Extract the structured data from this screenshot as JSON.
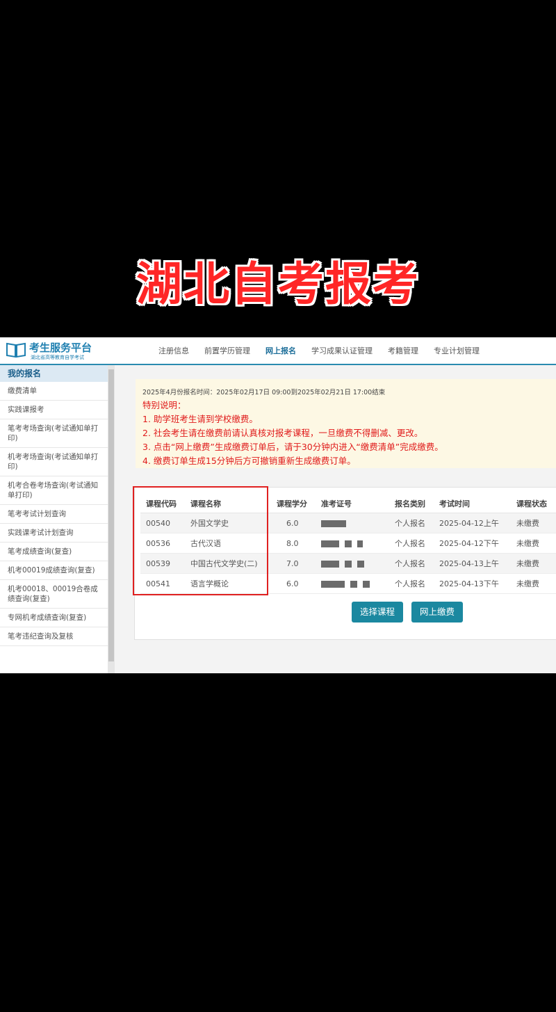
{
  "overlay_title": "湖北自考报考",
  "header": {
    "logo_title": "考生服务平台",
    "logo_subtitle": "湖北省高等教育自学考试",
    "nav": [
      "注册信息",
      "前置学历管理",
      "网上报名",
      "学习成果认证管理",
      "考籍管理",
      "专业计划管理"
    ],
    "active_nav": "网上报名"
  },
  "sidebar": {
    "title": "我的报名",
    "items": [
      "缴费清单",
      "实践课报考",
      "笔考考场查询(考试通知单打印)",
      "机考考场查询(考试通知单打印)",
      "机考合卷考场查询(考试通知单打印)",
      "笔考考试计划查询",
      "实践课考试计划查询",
      "笔考成绩查询(复查)",
      "机考00019成绩查询(复查)",
      "机考00018、00019合卷成绩查询(复查)",
      "专网机考成绩查询(复查)",
      "笔考违纪查询及复核"
    ]
  },
  "notice": {
    "period": "2025年4月份报名时间：2025年02月17日 09:00到2025年02月21日 17:00结束",
    "heading": "特别说明：",
    "lines": [
      "1. 助学班考生请到学校缴费。",
      "2. 社会考生请在缴费前请认真核对报考课程，一旦缴费不得删减、更改。",
      "3. 点击“网上缴费”生成缴费订单后，请于30分钟内进入“缴费清单”完成缴费。",
      "4. 缴费订单生成15分钟后方可撤销重新生成缴费订单。"
    ]
  },
  "table": {
    "columns": [
      "课程代码",
      "课程名称",
      "课程学分",
      "准考证号",
      "报名类别",
      "考试时间",
      "课程状态"
    ],
    "rows": [
      {
        "code": "00540",
        "name": "外国文学史",
        "credit": "6.0",
        "category": "个人报名",
        "time": "2025-04-12上午",
        "status": "未缴费"
      },
      {
        "code": "00536",
        "name": "古代汉语",
        "credit": "8.0",
        "category": "个人报名",
        "time": "2025-04-12下午",
        "status": "未缴费"
      },
      {
        "code": "00539",
        "name": "中国古代文学史(二)",
        "credit": "7.0",
        "category": "个人报名",
        "time": "2025-04-13上午",
        "status": "未缴费"
      },
      {
        "code": "00541",
        "name": "语言学概论",
        "credit": "6.0",
        "category": "个人报名",
        "time": "2025-04-13下午",
        "status": "未缴费"
      }
    ]
  },
  "buttons": {
    "select_course": "选择课程",
    "online_pay": "网上缴费"
  },
  "colors": {
    "accent": "#1b88a0",
    "notice_text": "#e01a1a",
    "highlight_box": "#e02020"
  }
}
